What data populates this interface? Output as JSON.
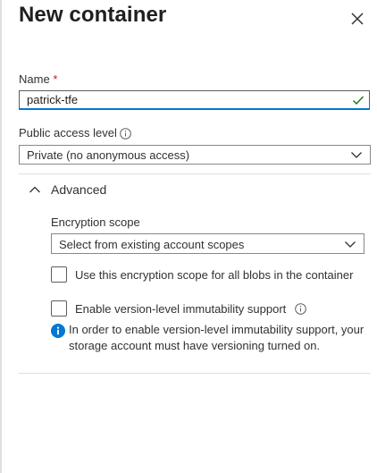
{
  "panel": {
    "title": "New container",
    "close_label": "Close"
  },
  "name_field": {
    "label": "Name",
    "required_mark": "*",
    "value": "patrick-tfe"
  },
  "public_access": {
    "label": "Public access level",
    "selected": "Private (no anonymous access)"
  },
  "advanced": {
    "label": "Advanced",
    "expanded": true,
    "encryption_scope": {
      "label": "Encryption scope",
      "placeholder": "Select from existing account scopes"
    },
    "use_scope_checkbox": {
      "label": "Use this encryption scope for all blobs in the container",
      "checked": false
    },
    "immutability_checkbox": {
      "label": "Enable version-level immutability support",
      "checked": false
    },
    "info_note": "In order to enable version-level immutability support, your storage account must have versioning turned on."
  },
  "colors": {
    "accent": "#0078d4",
    "success": "#107c10",
    "required": "#a4262c",
    "border": "#8a8886",
    "divider": "#e1dfdd"
  },
  "icons": [
    "close-icon",
    "checkmark-icon",
    "info-icon",
    "chevron-down-icon",
    "chevron-up-icon",
    "info-filled-icon"
  ]
}
